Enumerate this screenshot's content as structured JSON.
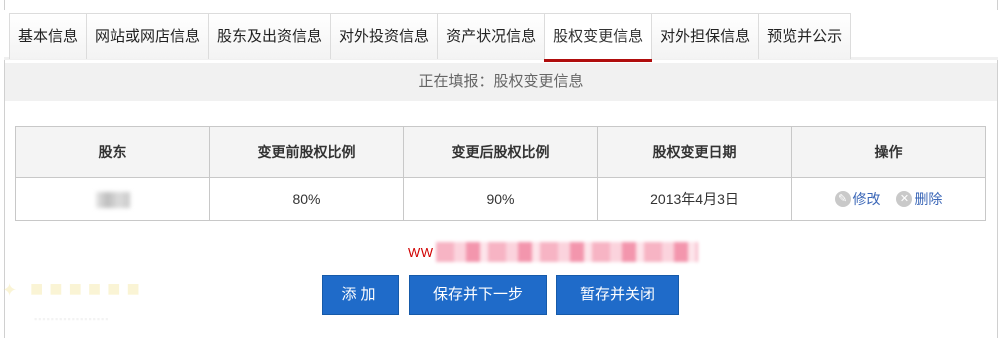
{
  "tabs": [
    {
      "label": "基本信息",
      "active": false
    },
    {
      "label": "网站或网店信息",
      "active": false
    },
    {
      "label": "股东及出资信息",
      "active": false
    },
    {
      "label": "对外投资信息",
      "active": false
    },
    {
      "label": "资产状况信息",
      "active": false
    },
    {
      "label": "股权变更信息",
      "active": true
    },
    {
      "label": "对外担保信息",
      "active": false
    },
    {
      "label": "预览并公示",
      "active": false
    }
  ],
  "status": {
    "text": "正在填报：股权变更信息"
  },
  "table": {
    "headers": [
      "股东",
      "变更前股权比例",
      "变更后股权比例",
      "股权变更日期",
      "操作"
    ],
    "rows": [
      {
        "before": "80%",
        "after": "90%",
        "date": "2013年4月3日",
        "edit_label": "修改",
        "delete_label": "删除"
      }
    ]
  },
  "masked_link": {
    "prefix": "WW"
  },
  "buttons": {
    "add": "添加",
    "save_next": "保存并下一步",
    "save_close": "暂存并关闭"
  },
  "colors": {
    "accent": "#1f6bc9",
    "active_tab_underline": "#b00d0d",
    "link": "#3a66b7",
    "warning_text": "#d10000"
  },
  "icons": {
    "edit": "pencil-icon",
    "delete": "close-circle-icon"
  }
}
